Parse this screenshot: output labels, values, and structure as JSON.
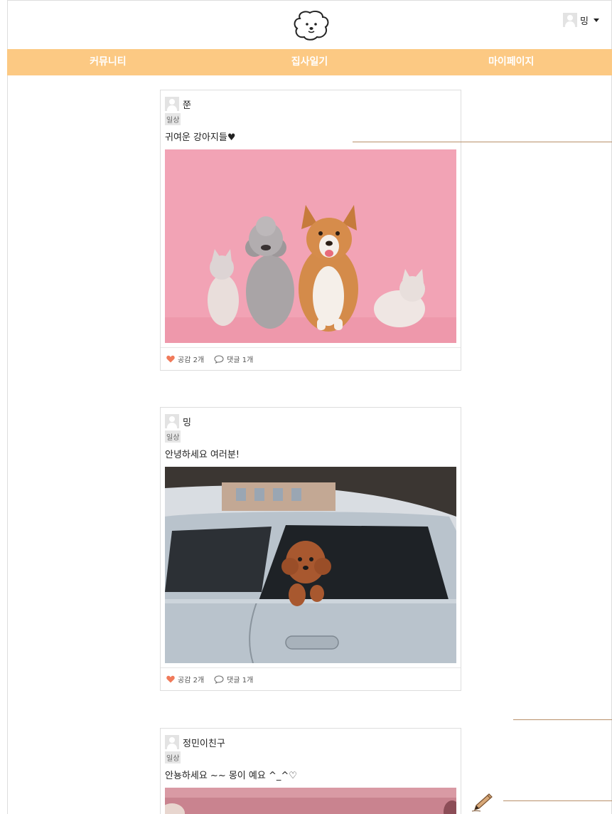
{
  "header": {
    "user_name": "밍"
  },
  "nav": {
    "tabs": [
      "커뮤니티",
      "집사일기",
      "마이페이지"
    ]
  },
  "posts": [
    {
      "author": "쭌",
      "category": "일상",
      "title": "귀여운 강아지들♥",
      "likes": "공감 2개",
      "comments": "댓글 1개"
    },
    {
      "author": "밍",
      "category": "일상",
      "title": "안녕하세요 여러분!",
      "likes": "공감 2개",
      "comments": "댓글 1개"
    },
    {
      "author": "정민이친구",
      "category": "일상",
      "title": "안뇽하세요 ~~ 몽이 예요 ^_^♡"
    }
  ],
  "colors": {
    "nav_bg": "#fcc983",
    "heart": "#f07a5a",
    "photo1_bg": "#f2a3b5"
  }
}
